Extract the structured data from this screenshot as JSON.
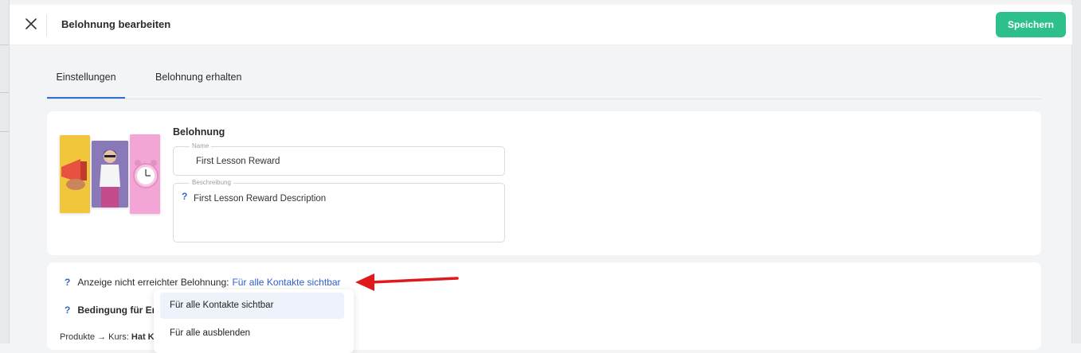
{
  "header": {
    "title": "Belohnung bearbeiten",
    "save_label": "Speichern",
    "close_icon": "close-icon"
  },
  "tabs": [
    {
      "label": "Einstellungen",
      "active": true
    },
    {
      "label": "Belohnung erhalten",
      "active": false
    }
  ],
  "reward": {
    "section_label": "Belohnung",
    "name_label": "Name",
    "name_value": "First Lesson Reward",
    "description_label": "Beschreibung",
    "description_value": "First Lesson Reward Description",
    "help_icon": "?"
  },
  "visibility": {
    "label": "Anzeige nicht erreichter Belohnung:",
    "selected": "Für alle Kontakte sichtbar",
    "condition_label": "Bedingung für Er",
    "condition_path_prefix": "Produkte → Kurs:",
    "condition_path_bold": "Hat K",
    "help_icon": "?"
  },
  "dropdown": {
    "options": [
      "Für alle Kontakte sichtbar",
      "Für alle ausblenden"
    ]
  },
  "colors": {
    "accent": "#2f6fd6",
    "save_button": "#2ec08b",
    "link": "#2f5fd0",
    "annotation_arrow": "#e0191b"
  }
}
